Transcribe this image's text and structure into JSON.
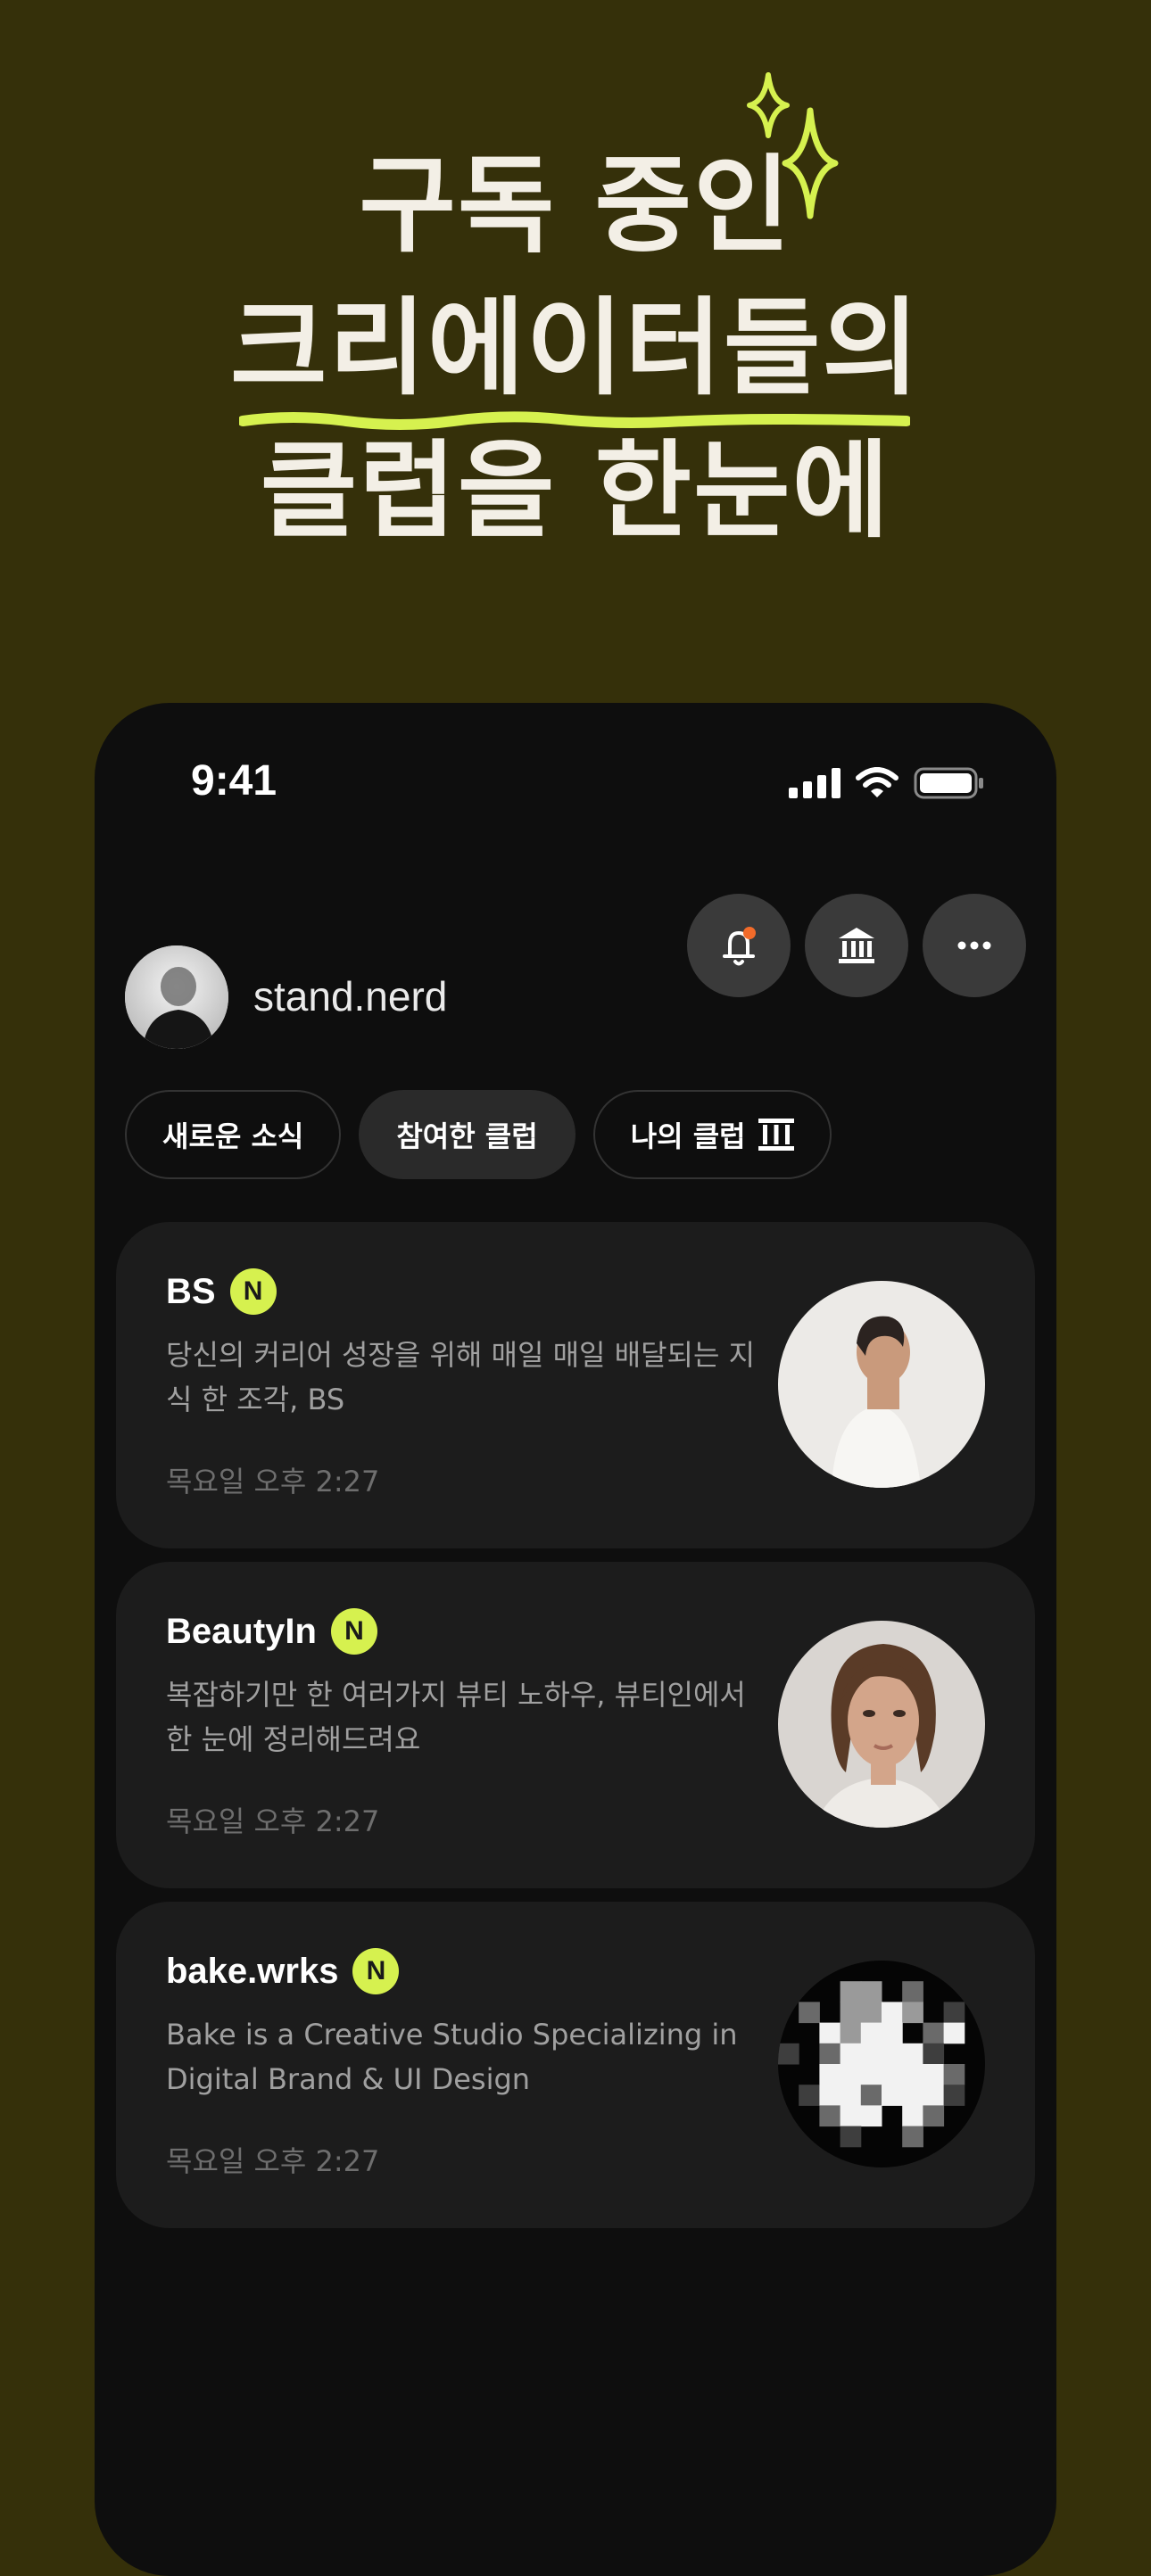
{
  "promo": {
    "line1": "구독 중인",
    "line2": "크리에이터들의",
    "line3": "클럽을 한눈에"
  },
  "colors": {
    "background": "#35300a",
    "accent": "#d6f14f",
    "phone": "#0e0e0e",
    "card": "#1c1c1c",
    "headline": "#f3efe6"
  },
  "status_bar": {
    "time": "9:41",
    "icons": [
      "signal-icon",
      "wifi-icon",
      "battery-icon"
    ]
  },
  "header": {
    "buttons": [
      "notification-bell-icon",
      "bank-icon",
      "more-icon"
    ],
    "username": "stand.nerd"
  },
  "tabs": [
    {
      "label": "새로운 소식",
      "active": false
    },
    {
      "label": "참여한 클럽",
      "active": true
    },
    {
      "label": "나의 클럽",
      "active": false,
      "icon": "pillar-icon"
    }
  ],
  "clubs": [
    {
      "name": "BS",
      "badge": "N",
      "description": "당신의 커리어 성장을 위해 매일 매일 배달되는 지식 한 조각, BS",
      "time": "목요일 오후 2:27",
      "thumbnail": "man-profile-photo"
    },
    {
      "name": "BeautyIn",
      "badge": "N",
      "description": "복잡하기만 한 여러가지 뷰티 노하우, 뷰티인에서 한 눈에 정리해드려요",
      "time": "목요일 오후 2:27",
      "thumbnail": "woman-portrait-photo"
    },
    {
      "name": "bake.wrks",
      "badge": "N",
      "description": "Bake is a Creative Studio Specializing in Digital Brand & UI Design",
      "time": "목요일 오후 2:27",
      "thumbnail": "pixel-art-logo"
    }
  ]
}
